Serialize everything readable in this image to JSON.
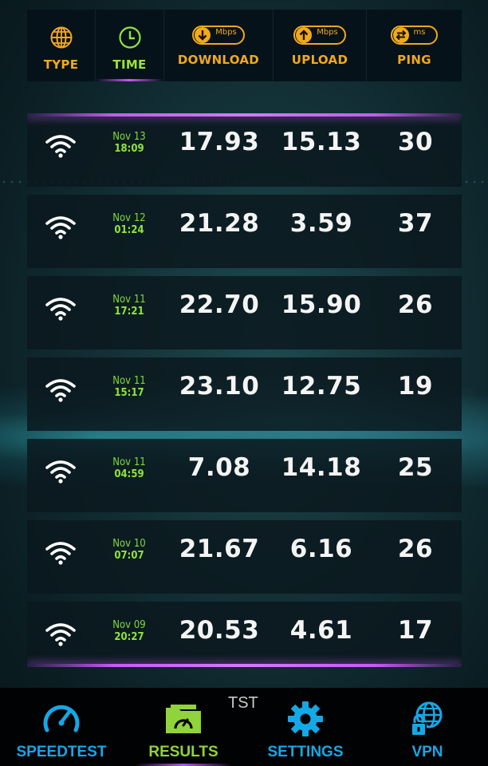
{
  "header": {
    "columns": [
      {
        "label": "TYPE",
        "icon": "globe-icon"
      },
      {
        "label": "TIME",
        "icon": "clock-icon",
        "active": true
      },
      {
        "label": "DOWNLOAD",
        "icon": "download-arrow-icon",
        "unit": "Mbps"
      },
      {
        "label": "UPLOAD",
        "icon": "upload-arrow-icon",
        "unit": "Mbps"
      },
      {
        "label": "PING",
        "icon": "ping-arrows-icon",
        "unit": "ms"
      }
    ]
  },
  "results": [
    {
      "type": "wifi-icon",
      "date": "Nov 13",
      "time": "18:09",
      "download": "17.93",
      "upload": "15.13",
      "ping": "30"
    },
    {
      "type": "wifi-icon",
      "date": "Nov 12",
      "time": "01:24",
      "download": "21.28",
      "upload": "3.59",
      "ping": "37"
    },
    {
      "type": "wifi-icon",
      "date": "Nov 11",
      "time": "17:21",
      "download": "22.70",
      "upload": "15.90",
      "ping": "26"
    },
    {
      "type": "wifi-icon",
      "date": "Nov 11",
      "time": "15:17",
      "download": "23.10",
      "upload": "12.75",
      "ping": "19"
    },
    {
      "type": "wifi-icon",
      "date": "Nov 11",
      "time": "04:59",
      "download": "7.08",
      "upload": "14.18",
      "ping": "25"
    },
    {
      "type": "wifi-icon",
      "date": "Nov 10",
      "time": "07:07",
      "download": "21.67",
      "upload": "6.16",
      "ping": "26"
    },
    {
      "type": "wifi-icon",
      "date": "Nov 09",
      "time": "20:27",
      "download": "20.53",
      "upload": "4.61",
      "ping": "17"
    }
  ],
  "overlay_text": "TST",
  "nav": [
    {
      "label": "SPEEDTEST",
      "icon": "speedometer-icon"
    },
    {
      "label": "RESULTS",
      "icon": "results-folder-icon",
      "active": true
    },
    {
      "label": "SETTINGS",
      "icon": "gear-icon"
    },
    {
      "label": "VPN",
      "icon": "globe-lock-icon"
    }
  ],
  "colors": {
    "header_accent": "#f2a91a",
    "active_green": "#8fe53c",
    "nav_blue": "#15a8e6",
    "glow_purple": "#c45cf3"
  }
}
